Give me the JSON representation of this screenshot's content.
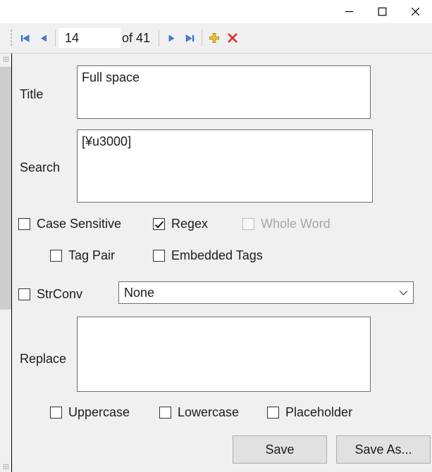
{
  "window": {
    "controls": [
      {
        "name": "minimize",
        "glyph": "minimize-icon"
      },
      {
        "name": "maximize",
        "glyph": "maximize-icon"
      },
      {
        "name": "close",
        "glyph": "close-icon"
      }
    ]
  },
  "toolbar": {
    "first_icon": "first-record-icon",
    "prev_icon": "previous-record-icon",
    "next_icon": "next-record-icon",
    "last_icon": "last-record-icon",
    "add_icon": "add-record-icon",
    "delete_icon": "delete-record-icon",
    "page_value": "14",
    "page_placeholder": "",
    "of_label": "of 41",
    "total": "41",
    "current": "14",
    "accent_blue": "#2a6ed4",
    "accent_gold": "#e8b21f",
    "accent_red": "#e03131"
  },
  "form": {
    "title": {
      "label": "Title",
      "value": "Full space",
      "placeholder": ""
    },
    "search": {
      "label": "Search",
      "value": "[¥u3000]",
      "placeholder": ""
    },
    "replace": {
      "label": "Replace",
      "value": "",
      "placeholder": ""
    },
    "options_row1": [
      {
        "label": "Case Sensitive",
        "checked": false,
        "disabled": false
      },
      {
        "label": "Regex",
        "checked": true,
        "disabled": false
      },
      {
        "label": "Whole Word",
        "checked": false,
        "disabled": true
      }
    ],
    "options_row2": [
      {
        "label": "Tag Pair",
        "checked": false,
        "disabled": false
      },
      {
        "label": "Embedded Tags",
        "checked": false,
        "disabled": false
      }
    ],
    "strconv": {
      "label": "StrConv",
      "checked": false,
      "selected": "None",
      "options": [
        "None"
      ]
    },
    "case_row": [
      {
        "label": "Uppercase",
        "checked": false,
        "disabled": false
      },
      {
        "label": "Lowercase",
        "checked": false,
        "disabled": false
      },
      {
        "label": "Placeholder",
        "checked": false,
        "disabled": false
      }
    ],
    "buttons": {
      "save": "Save",
      "save_as": "Save As..."
    }
  }
}
